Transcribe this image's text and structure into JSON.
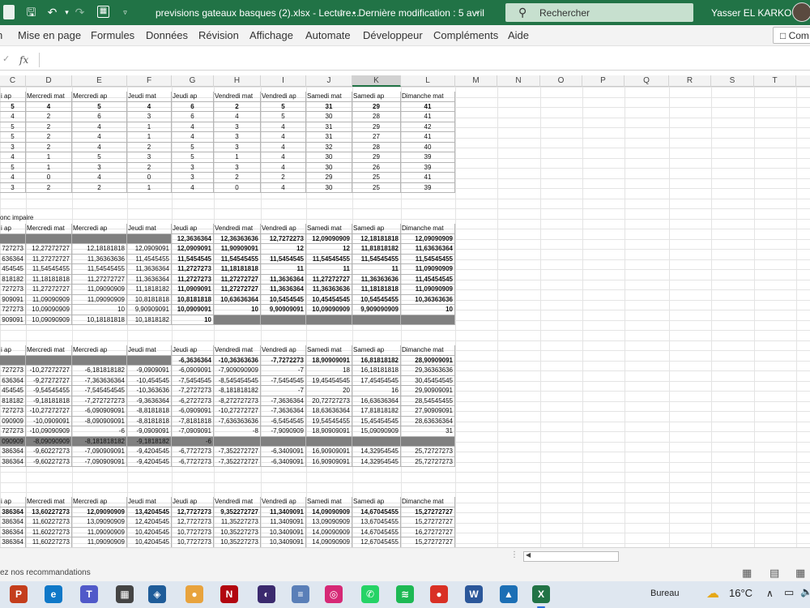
{
  "titlebar": {
    "doc_title": "previsions gateaux basques (2).xlsx  -  Lecture...",
    "modified": "• Dernière modification : 5 avril",
    "search_placeholder": "Rechercher",
    "user": "Yasser EL KARKOURI"
  },
  "ribbon": {
    "tabs": [
      "n",
      "Mise en page",
      "Formules",
      "Données",
      "Révision",
      "Affichage",
      "Automate",
      "Développeur",
      "Compléments",
      "Aide"
    ],
    "comments": "Com"
  },
  "columns": [
    "C",
    "D",
    "E",
    "F",
    "G",
    "H",
    "I",
    "J",
    "K",
    "L",
    "M",
    "N",
    "O",
    "P",
    "Q",
    "R",
    "S",
    "T"
  ],
  "selected_column": "K",
  "section_label": "onc impaire",
  "headers": {
    "t1": [
      "i ap",
      "Mercredi mat",
      "Mercredi ap",
      "Jeudi mat",
      "Jeudi ap",
      "Vendredi mat",
      "Vendredi ap",
      "Samedi mat",
      "Samedi ap",
      "Dimanche mat"
    ],
    "t2": [
      "i ap",
      "Mercredi mat",
      "Mercredi ap",
      "Jeudi mat",
      "Jeudi ap",
      "Vendredi mat",
      "Vendredi ap",
      "Samedi mat",
      "Samedi ap",
      "Dimanche mat"
    ],
    "t3": [
      "i ap",
      "Mercredi mat",
      "Mercredi ap",
      "Jeudi mat",
      "Jeudi ap",
      "Vendredi mat",
      "Vendredi ap",
      "Samedi mat",
      "Samedi ap",
      "Dimanche mat"
    ],
    "t4": [
      "i ap",
      "Mercredi mat",
      "Mercredi ap",
      "Jeudi mat",
      "Jeudi ap",
      "Vendredi mat",
      "Vendredi ap",
      "Samedi mat",
      "Samedi ap",
      "Dimanche mat"
    ]
  },
  "table1": [
    [
      "5",
      "4",
      "5",
      "4",
      "6",
      "2",
      "5",
      "31",
      "29",
      "41"
    ],
    [
      "4",
      "2",
      "6",
      "3",
      "6",
      "4",
      "5",
      "30",
      "28",
      "41"
    ],
    [
      "5",
      "2",
      "4",
      "1",
      "4",
      "3",
      "4",
      "31",
      "29",
      "42"
    ],
    [
      "5",
      "2",
      "4",
      "1",
      "4",
      "3",
      "4",
      "31",
      "27",
      "41"
    ],
    [
      "3",
      "2",
      "4",
      "2",
      "5",
      "3",
      "4",
      "32",
      "28",
      "40"
    ],
    [
      "4",
      "1",
      "5",
      "3",
      "5",
      "1",
      "4",
      "30",
      "29",
      "39"
    ],
    [
      "5",
      "1",
      "3",
      "2",
      "3",
      "3",
      "4",
      "30",
      "26",
      "39"
    ],
    [
      "4",
      "0",
      "4",
      "0",
      "3",
      "2",
      "2",
      "29",
      "25",
      "41"
    ],
    [
      "3",
      "2",
      "2",
      "1",
      "4",
      "0",
      "4",
      "30",
      "25",
      "39"
    ]
  ],
  "table2": [
    [
      "",
      "",
      "",
      "",
      "12,3636364",
      "12,36363636",
      "12,7272273",
      "12,09090909",
      "12,18181818",
      "12,09090909"
    ],
    [
      "727273",
      "12,27272727",
      "12,18181818",
      "12,0909091",
      "12,0909091",
      "11,90909091",
      "12",
      "12",
      "11,81818182",
      "11,63636364"
    ],
    [
      "636364",
      "11,27272727",
      "11,36363636",
      "11,4545455",
      "11,5454545",
      "11,54545455",
      "11,5454545",
      "11,54545455",
      "11,54545455",
      "11,54545455"
    ],
    [
      "454545",
      "11,54545455",
      "11,54545455",
      "11,3636364",
      "11,2727273",
      "11,18181818",
      "11",
      "11",
      "11",
      "11,09090909"
    ],
    [
      "818182",
      "11,18181818",
      "11,27272727",
      "11,3636364",
      "11,2727273",
      "11,27272727",
      "11,3636364",
      "11,27272727",
      "11,36363636",
      "11,45454545"
    ],
    [
      "727273",
      "11,27272727",
      "11,09090909",
      "11,1818182",
      "11,0909091",
      "11,27272727",
      "11,3636364",
      "11,36363636",
      "11,18181818",
      "11,09090909"
    ],
    [
      "909091",
      "11,09090909",
      "11,09090909",
      "10,8181818",
      "10,8181818",
      "10,63636364",
      "10,5454545",
      "10,45454545",
      "10,54545455",
      "10,36363636"
    ],
    [
      "727273",
      "10,09090909",
      "10",
      "9,90909091",
      "10,0909091",
      "10",
      "9,90909091",
      "10,09090909",
      "9,909090909",
      "10"
    ],
    [
      "909091",
      "10,09090909",
      "10,18181818",
      "10,1818182",
      "10",
      "",
      "",
      "",
      "",
      ""
    ]
  ],
  "table3": [
    [
      "",
      "",
      "",
      "",
      "-6,3636364",
      "-10,36363636",
      "-7,7272273",
      "18,90909091",
      "16,81818182",
      "28,90909091"
    ],
    [
      "727273",
      "-10,27272727",
      "-6,181818182",
      "-9,0909091",
      "-6,0909091",
      "-7,909090909",
      "-7",
      "18",
      "16,18181818",
      "29,36363636"
    ],
    [
      "636364",
      "-9,27272727",
      "-7,363636364",
      "-10,454545",
      "-7,5454545",
      "-8,545454545",
      "-7,5454545",
      "19,45454545",
      "17,45454545",
      "30,45454545"
    ],
    [
      "454545",
      "-9,54545455",
      "-7,545454545",
      "-10,363636",
      "-7,2727273",
      "-8,181818182",
      "-7",
      "20",
      "16",
      "29,90909091"
    ],
    [
      "818182",
      "-9,18181818",
      "-7,272727273",
      "-9,3636364",
      "-6,2727273",
      "-8,272727273",
      "-7,3636364",
      "20,72727273",
      "16,63636364",
      "28,54545455"
    ],
    [
      "727273",
      "-10,27272727",
      "-6,090909091",
      "-8,8181818",
      "-6,0909091",
      "-10,27272727",
      "-7,3636364",
      "18,63636364",
      "17,81818182",
      "27,90909091"
    ],
    [
      "090909",
      "-10,0909091",
      "-8,090909091",
      "-8,8181818",
      "-7,8181818",
      "-7,636363636",
      "-6,5454545",
      "19,54545455",
      "15,45454545",
      "28,63636364"
    ],
    [
      "727273",
      "-10,09090909",
      "-6",
      "-9,0909091",
      "-7,0909091",
      "-8",
      "-7,9090909",
      "18,90909091",
      "15,09090909",
      "31"
    ],
    [
      "090909",
      "-8,09090909",
      "-8,181818182",
      "-9,1818182",
      "-6",
      "",
      "",
      "",
      "",
      ""
    ],
    [
      "386364",
      "-9,60227273",
      "-7,090909091",
      "-9,4204545",
      "-6,7727273",
      "-7,352272727",
      "-6,3409091",
      "16,90909091",
      "14,32954545",
      "25,72727273"
    ],
    [
      "386364",
      "-9,60227273",
      "-7,090909091",
      "-9,4204545",
      "-6,7727273",
      "-7,352272727",
      "-6,3409091",
      "16,90909091",
      "14,32954545",
      "25,72727273"
    ]
  ],
  "table4": [
    [
      "386364",
      "13,60227273",
      "12,09090909",
      "13,4204545",
      "12,7727273",
      "9,352272727",
      "11,3409091",
      "14,09090909",
      "14,67045455",
      "15,27272727"
    ],
    [
      "386364",
      "11,60227273",
      "13,09090909",
      "12,4204545",
      "12,7727273",
      "11,35227273",
      "11,3409091",
      "13,09090909",
      "13,67045455",
      "15,27272727"
    ],
    [
      "386364",
      "11,60227273",
      "11,09090909",
      "10,4204545",
      "10,7727273",
      "10,35227273",
      "10,3409091",
      "14,09090909",
      "14,67045455",
      "16,27272727"
    ],
    [
      "386364",
      "11,60227273",
      "11,09090909",
      "10,4204545",
      "10,7727273",
      "10,35227273",
      "10,3409091",
      "14,09090909",
      "12,67045455",
      "15,27272727"
    ]
  ],
  "statusbar": {
    "message": "ez nos recommandations"
  },
  "taskbar": {
    "items": [
      {
        "name": "powerpoint-icon",
        "glyph": "P",
        "color": "#c43e1c"
      },
      {
        "name": "edge-icon",
        "glyph": "e",
        "color": "#0f78c8"
      },
      {
        "name": "teams-icon",
        "glyph": "T",
        "color": "#5059c9"
      },
      {
        "name": "calculator-icon",
        "glyph": "▦",
        "color": "#444444"
      },
      {
        "name": "virtualbox-icon",
        "glyph": "◈",
        "color": "#1f5c99"
      },
      {
        "name": "chrome-icon",
        "glyph": "●",
        "color": "#e8a33d"
      },
      {
        "name": "netflix-icon",
        "glyph": "N",
        "color": "#b20710"
      },
      {
        "name": "eclipse-icon",
        "glyph": "◐",
        "color": "#3b2a6e"
      },
      {
        "name": "notepad-icon",
        "glyph": "≡",
        "color": "#5a7fb8"
      },
      {
        "name": "instagram-icon",
        "glyph": "◎",
        "color": "#d62976"
      },
      {
        "name": "whatsapp-icon",
        "glyph": "✆",
        "color": "#25d366"
      },
      {
        "name": "spotify-icon",
        "glyph": "≋",
        "color": "#1db954"
      },
      {
        "name": "chrome-profile-icon",
        "glyph": "●",
        "color": "#d93025"
      },
      {
        "name": "word-icon",
        "glyph": "W",
        "color": "#2b579a"
      },
      {
        "name": "photos-icon",
        "glyph": "▲",
        "color": "#1c6fb5"
      },
      {
        "name": "excel-icon",
        "glyph": "X",
        "color": "#217346"
      }
    ],
    "weather_label": "Bureau",
    "temperature": "16°C"
  },
  "colors": {
    "accent": "#217346",
    "header_gray": "#808080"
  }
}
